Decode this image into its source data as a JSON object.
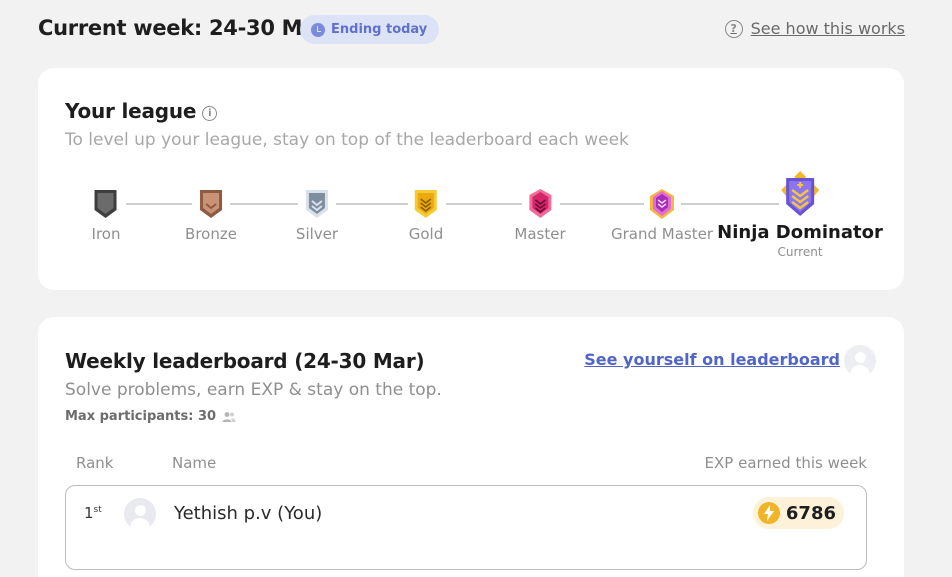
{
  "header": {
    "week_title": "Current week: 24-30 Mar",
    "status_badge": "Ending today",
    "help_link": "See how this works"
  },
  "league": {
    "title": "Your league",
    "subtitle": "To level up your league, stay on top of the leaderboard each week",
    "tiers": [
      {
        "name": "Iron",
        "color": "#4a4a4a"
      },
      {
        "name": "Bronze",
        "color": "#b07a5c"
      },
      {
        "name": "Silver",
        "color": "#7d8a99"
      },
      {
        "name": "Gold",
        "color": "#f2b824"
      },
      {
        "name": "Master",
        "color": "#e23d7a"
      },
      {
        "name": "Grand Master",
        "color": "#c84fd1"
      },
      {
        "name": "Ninja Dominator",
        "color": "#7b5ce0"
      }
    ],
    "current_label": "Current"
  },
  "leaderboard": {
    "title": "Weekly leaderboard (24-30 Mar)",
    "subtitle": "Solve problems, earn EXP & stay on the top.",
    "see_yourself": "See yourself on leaderboard",
    "max_participants_label": "Max participants: 30",
    "columns": {
      "rank": "Rank",
      "name": "Name",
      "exp": "EXP earned this week"
    },
    "rows": [
      {
        "rank": "1",
        "rank_suffix": "st",
        "name": "Yethish p.v (You)",
        "exp": "6786"
      }
    ]
  }
}
